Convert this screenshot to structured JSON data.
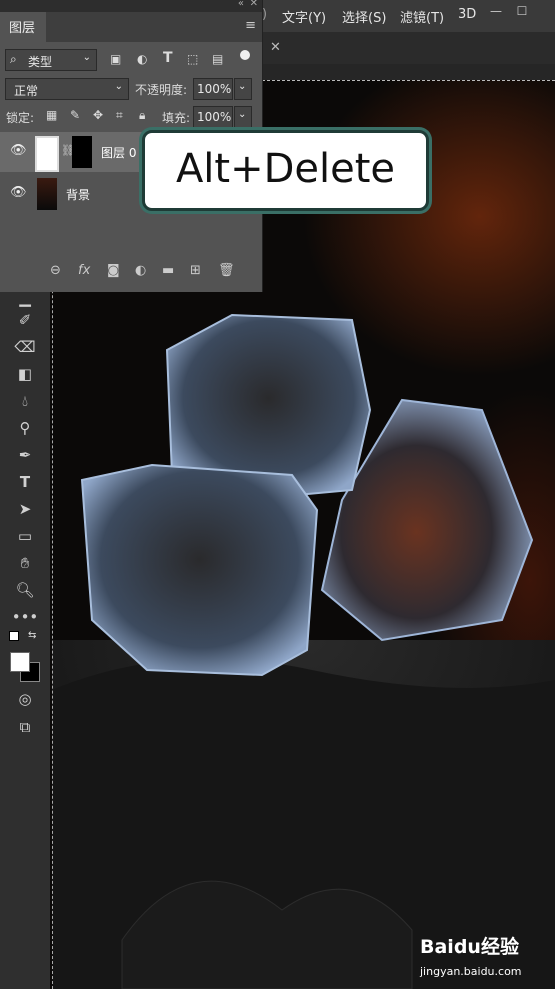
{
  "menu": {
    "items": [
      "文字(Y)",
      "选择(S)",
      "滤镜(T)",
      "3D"
    ],
    "window_buttons": [
      "—",
      "☐"
    ]
  },
  "layers_panel": {
    "tab_label": "图层",
    "filter_label": "类型",
    "blend_mode": "正常",
    "opacity_label": "不透明度:",
    "opacity_value": "100%",
    "lock_label": "锁定:",
    "fill_label": "填充:",
    "fill_value": "100%",
    "layers": [
      {
        "name": "图层 0"
      },
      {
        "name": "背景"
      }
    ],
    "footer_icons": [
      "link-icon",
      "fx-icon",
      "mask-icon",
      "adjustment-icon",
      "folder-icon",
      "new-layer-icon",
      "trash-icon"
    ]
  },
  "callout": {
    "text": "Alt+Delete"
  },
  "watermark": {
    "brand": "Baidu经验",
    "url": "jingyan.baidu.com"
  },
  "colors": {
    "panel_bg": "#535353",
    "callout_border": "#1f3b36",
    "canvas_bg": "#0b0908"
  }
}
